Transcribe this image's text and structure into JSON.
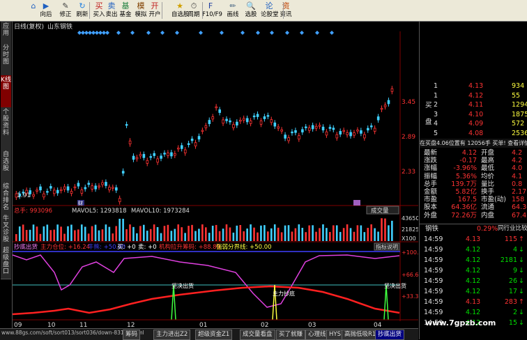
{
  "toolbar": {
    "buttons": [
      {
        "label": "向后",
        "icon": "back-arrow-icon"
      },
      {
        "label": "修正",
        "icon": "edit-icon"
      },
      {
        "label": "刷新",
        "icon": "refresh-icon"
      },
      {
        "label": "买入",
        "icon": "buy-icon"
      },
      {
        "label": "卖出",
        "icon": "sell-icon"
      },
      {
        "label": "基金",
        "icon": "fund-icon"
      },
      {
        "label": "模拟",
        "icon": "simulate-icon"
      },
      {
        "label": "开户",
        "icon": "account-icon"
      },
      {
        "label": "自选股",
        "icon": "favorites-icon"
      },
      {
        "label": "周期",
        "icon": "period-icon"
      },
      {
        "label": "F10/F9",
        "icon": "info-icon"
      },
      {
        "label": "画线",
        "icon": "draw-line-icon"
      },
      {
        "label": "选股",
        "icon": "stock-select-icon"
      },
      {
        "label": "论股堂",
        "icon": "forum-icon"
      },
      {
        "label": "资讯",
        "icon": "news-icon"
      }
    ]
  },
  "left_tabs": [
    "应用",
    "分时图",
    "K线图",
    "个股资料",
    "自选股",
    "综合排名",
    "牛叉诊股",
    "超级盘口"
  ],
  "chart": {
    "header_mode": "日线(复权)",
    "stock_name": "山东钢铁",
    "price_labels": [
      "3.45",
      "2.89",
      "2.33"
    ],
    "low_label": "1.91",
    "cai_label": "财",
    "volume": {
      "total_label": "总手: 993096",
      "ma5_label": "MAVOL5: 1293818",
      "ma10_label": "MAVOL10: 1973284",
      "indicator_name": "成交量",
      "axis_labels": [
        "43650",
        "21825",
        "X100"
      ]
    },
    "indicator": {
      "name": "抄底出货",
      "items": [
        "主力仓位: +16.24",
        "牛熊: +50.00",
        "买: +0",
        "卖: +0",
        "机构拉升筹码: +88.89",
        "强弱分界线: +50.00"
      ],
      "help_label": "指标说明",
      "axis_labels": [
        "+100.0",
        "+66.67",
        "+33.33"
      ],
      "annotations": [
        "坚决出货",
        "主力抄底",
        "坚决出货"
      ]
    },
    "x_labels": [
      "09",
      "10",
      "11",
      "12",
      "01",
      "02",
      "03",
      "04"
    ]
  },
  "bottom_tabs": [
    "筹码",
    "主力进出Z2",
    "超级资金Z1",
    "成交量看盘",
    "买了就赚",
    "心理线",
    "HYS",
    "高抛低吸R1",
    "抄底出货"
  ],
  "bottom_tab_active": "抄底出货",
  "status_url": "www.88gs.com/soft/sort013/sort036/down-83108.html",
  "watermark": "www.7gpzb.com",
  "right_panel": {
    "buy_rows": [
      {
        "n": "1",
        "price": "4.13",
        "vol": "934"
      },
      {
        "n": "1",
        "price": "4.12",
        "vol": "55"
      },
      {
        "n": "2",
        "price": "4.11",
        "vol": "1294"
      },
      {
        "n": "3",
        "price": "4.10",
        "vol": "1875"
      },
      {
        "n": "4",
        "price": "4.09",
        "vol": "572"
      },
      {
        "n": "5",
        "price": "4.08",
        "vol": "2536"
      }
    ],
    "buy_label_1": "买",
    "buy_label_2": "盘",
    "order_info": "在买盘4.06位置有  12056手  买单! 查看详情",
    "stats": [
      {
        "k": "最新",
        "v": "4.12",
        "k2": "开盘",
        "v2": "4.2"
      },
      {
        "k": "涨跌",
        "v": "-0.17",
        "k2": "最高",
        "v2": "4.2"
      },
      {
        "k": "涨幅",
        "v": "-3.96%",
        "k2": "最低",
        "v2": "4.0"
      },
      {
        "k": "振幅",
        "v": "5.36%",
        "k2": "均价",
        "v2": "4.1"
      },
      {
        "k": "总手",
        "v": "139.7万",
        "k2": "量比",
        "v2": "0.8"
      },
      {
        "k": "金额",
        "v": "5.82亿",
        "k2": "换手",
        "v2": "2.17"
      },
      {
        "k": "市盈",
        "v": "167.5",
        "k2": "市盈(动)",
        "v2": "158"
      },
      {
        "k": "股本",
        "v": "64.36亿",
        "k2": "流通",
        "v2": "64.36"
      },
      {
        "k": "外盘",
        "v": "72.26万",
        "k2": "内盘",
        "v2": "67.43"
      }
    ],
    "sector_name": "钢铁",
    "sector_pct": "0.29%",
    "sector_compare": "同行业比较",
    "ticks": [
      {
        "t": "14:59",
        "p": "4.13",
        "v": "115"
      },
      {
        "t": "14:59",
        "p": "4.12",
        "v": "4"
      },
      {
        "t": "14:59",
        "p": "4.12",
        "v": "2181"
      },
      {
        "t": "14:59",
        "p": "4.12",
        "v": "9"
      },
      {
        "t": "14:59",
        "p": "4.12",
        "v": "26"
      },
      {
        "t": "14:59",
        "p": "4.12",
        "v": "17"
      },
      {
        "t": "14:59",
        "p": "4.13",
        "v": "283"
      },
      {
        "t": "14:59",
        "p": "4.12",
        "v": "2"
      },
      {
        "t": "14:59",
        "p": "4.12",
        "v": "15"
      }
    ]
  },
  "colors": {
    "up": "#ff3333",
    "down": "#40d0ff",
    "accent": "#800000"
  }
}
